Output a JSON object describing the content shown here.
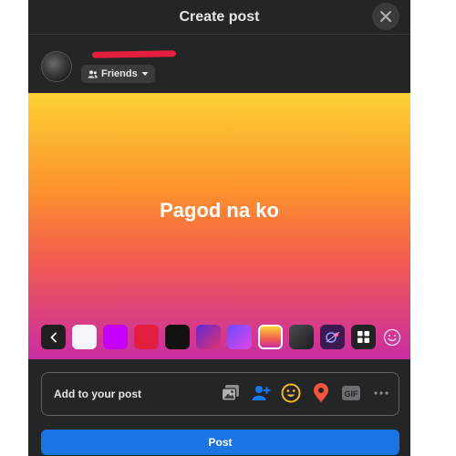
{
  "dialog": {
    "title": "Create post",
    "close_icon": "close-icon"
  },
  "user": {
    "name": "",
    "audience": "Friends",
    "audience_icon": "friends-icon",
    "dropdown_icon": "caret-down-icon"
  },
  "composer": {
    "text": "Pagod na ko",
    "background": "orange-pink-gradient",
    "background_colors": [
      "#fdd235",
      "#fc8f2e",
      "#f35d4f",
      "#c92da3"
    ]
  },
  "swatches": [
    {
      "name": "back",
      "icon": "chevron-left-icon"
    },
    {
      "name": "white",
      "color": "#f4f5f7"
    },
    {
      "name": "purple",
      "color": "#c600ff"
    },
    {
      "name": "red",
      "color": "#e41e3f"
    },
    {
      "name": "black",
      "color": "#111111"
    },
    {
      "name": "purple-pink-gradient"
    },
    {
      "name": "violet-pink-gradient"
    },
    {
      "name": "orange-pink-gradient",
      "selected": true
    },
    {
      "name": "dark-gray-gradient"
    },
    {
      "name": "illustration"
    },
    {
      "name": "more",
      "icon": "grid-icon"
    },
    {
      "name": "emoji",
      "icon": "smiley-icon"
    }
  ],
  "add_to_post": {
    "label": "Add to your post",
    "icons": [
      "photo-icon",
      "tag-people-icon",
      "feeling-icon",
      "check-in-icon",
      "gif-icon",
      "more-icon"
    ]
  },
  "actions": {
    "post_label": "Post",
    "post_color": "#1b74e4"
  },
  "colors": {
    "modal_bg": "#242526",
    "accent": "#1b74e4"
  }
}
